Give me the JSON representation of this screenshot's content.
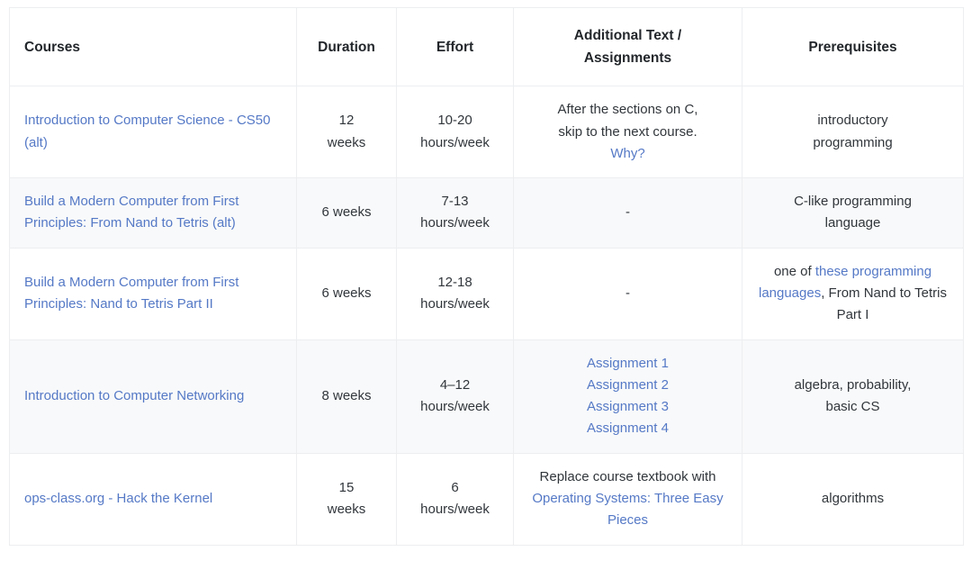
{
  "colors": {
    "link": "#5579c6",
    "text": "#31363b",
    "header_text": "#23272b",
    "border": "#eceef0",
    "row_alt_bg": "#f8f9fa",
    "row_bg": "#ffffff"
  },
  "table": {
    "columns": [
      {
        "key": "courses",
        "label": "Courses",
        "align": "left"
      },
      {
        "key": "duration",
        "label": "Duration",
        "align": "center"
      },
      {
        "key": "effort",
        "label": "Effort",
        "align": "center"
      },
      {
        "key": "additional",
        "label": "Additional Text / Assignments",
        "label_line1": "Additional Text /",
        "label_line2": "Assignments",
        "align": "center"
      },
      {
        "key": "prereq",
        "label": "Prerequisites",
        "align": "center"
      }
    ],
    "rows": [
      {
        "course": {
          "link_text": "Introduction to Computer Science - CS50",
          "alt_text": "(alt)"
        },
        "duration_line1": "12",
        "duration_line2": "weeks",
        "effort_line1": "10-20",
        "effort_line2": "hours/week",
        "additional": {
          "text_line1": "After the sections on C,",
          "text_line2": "skip to the next course.",
          "link": "Why?"
        },
        "prereq": {
          "line1": "introductory",
          "line2": "programming"
        }
      },
      {
        "course": {
          "link_text": "Build a Modern Computer from First Principles: From Nand to Tetris",
          "alt_text": "(alt)"
        },
        "duration_line1": "6 weeks",
        "duration_line2": "",
        "effort_line1": "7-13",
        "effort_line2": "hours/week",
        "additional": {
          "text_line1": "-",
          "text_line2": "",
          "link": ""
        },
        "prereq": {
          "line1": "C-like programming",
          "line2": "language"
        }
      },
      {
        "course": {
          "link_text": "Build a Modern Computer from First Principles: Nand to Tetris Part II",
          "alt_text": ""
        },
        "duration_line1": "6 weeks",
        "duration_line2": "",
        "effort_line1": "12-18",
        "effort_line2": "hours/week",
        "additional": {
          "text_line1": "-",
          "text_line2": "",
          "link": ""
        },
        "prereq": {
          "prefix": "one of ",
          "link": "these programming languages",
          "suffix": ", From Nand to Tetris Part I"
        }
      },
      {
        "course": {
          "link_text": "Introduction to Computer Networking",
          "alt_text": ""
        },
        "duration_line1": "8 weeks",
        "duration_line2": "",
        "effort_line1": "4–12",
        "effort_line2": "hours/week",
        "additional": {
          "assignments": [
            "Assignment 1",
            "Assignment 2",
            "Assignment 3",
            "Assignment 4"
          ]
        },
        "prereq": {
          "line1": "algebra, probability,",
          "line2": "basic CS"
        }
      },
      {
        "course": {
          "link_text": "ops-class.org - Hack the Kernel",
          "alt_text": ""
        },
        "duration_line1": "15",
        "duration_line2": "weeks",
        "effort_line1": "6",
        "effort_line2": "hours/week",
        "additional": {
          "prefix_line1": "Replace course textbook",
          "prefix_line2": "with ",
          "link": "Operating Systems: Three Easy Pieces"
        },
        "prereq": {
          "line1": "algorithms",
          "line2": ""
        }
      }
    ]
  }
}
